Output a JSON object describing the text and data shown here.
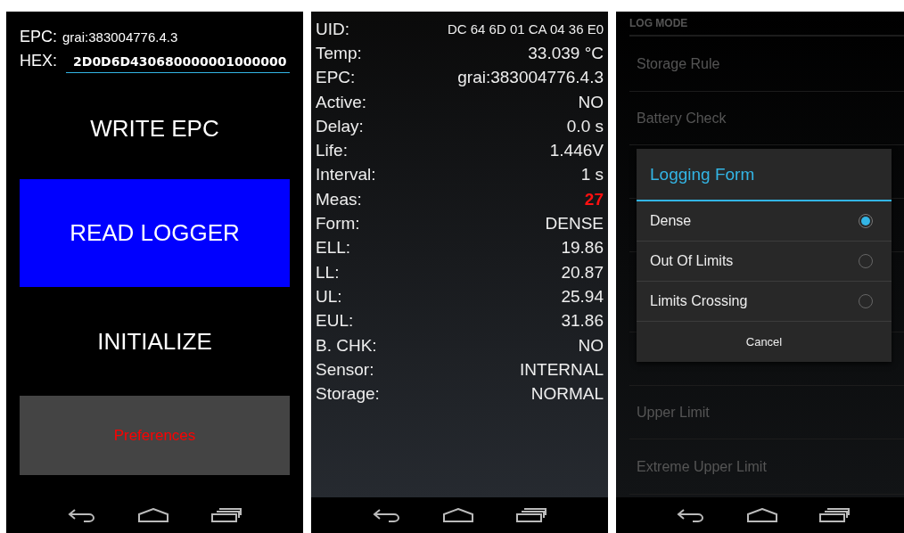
{
  "main_screen": {
    "epc_label": "EPC:",
    "epc_value": "grai:383004776.4.3",
    "hex_label": "HEX:",
    "hex_value": "2D0D6D430680000001000000",
    "buttons": [
      {
        "label": "WRITE EPC",
        "kind": "plain"
      },
      {
        "label": "READ LOGGER",
        "kind": "blue"
      },
      {
        "label": "INITIALIZE",
        "kind": "plain"
      },
      {
        "label": "Preferences",
        "kind": "gray"
      }
    ]
  },
  "logger_screen": {
    "rows": [
      {
        "label": "UID:",
        "value": "DC 64 6D 01 CA 04 36 E0",
        "highlighted": false,
        "small": true
      },
      {
        "label": "Temp:",
        "value": "33.039 °C",
        "highlighted": false,
        "small": false
      },
      {
        "label": "EPC:",
        "value": "grai:383004776.4.3",
        "highlighted": false,
        "small": false
      },
      {
        "label": "Active:",
        "value": "NO",
        "highlighted": false,
        "small": false
      },
      {
        "label": "Delay:",
        "value": "0.0 s",
        "highlighted": false,
        "small": false
      },
      {
        "label": "Life:",
        "value": "1.446V",
        "highlighted": false,
        "small": false
      },
      {
        "label": "Interval:",
        "value": "1 s",
        "highlighted": false,
        "small": false
      },
      {
        "label": "Meas:",
        "value": "27",
        "highlighted": true,
        "small": false
      },
      {
        "label": "Form:",
        "value": "DENSE",
        "highlighted": false,
        "small": false
      },
      {
        "label": "ELL:",
        "value": "19.86",
        "highlighted": false,
        "small": false
      },
      {
        "label": "LL:",
        "value": "20.87",
        "highlighted": false,
        "small": false
      },
      {
        "label": "UL:",
        "value": "25.94",
        "highlighted": false,
        "small": false
      },
      {
        "label": "EUL:",
        "value": "31.86",
        "highlighted": false,
        "small": false
      },
      {
        "label": "B. CHK:",
        "value": "NO",
        "highlighted": false,
        "small": false
      },
      {
        "label": "Sensor:",
        "value": "INTERNAL",
        "highlighted": false,
        "small": false
      },
      {
        "label": "Storage:",
        "value": "NORMAL",
        "highlighted": false,
        "small": false
      }
    ]
  },
  "preferences_screen": {
    "section": "LOG MODE",
    "items": [
      {
        "title": "Storage Rule"
      },
      {
        "title": "Battery Check"
      },
      {
        "title": "Upper Limit"
      },
      {
        "title": "Extreme Upper Limit"
      }
    ],
    "dialog": {
      "title": "Logging Form",
      "options": [
        {
          "label": "Dense",
          "selected": true
        },
        {
          "label": "Out Of Limits",
          "selected": false
        },
        {
          "label": "Limits Crossing",
          "selected": false
        }
      ],
      "cancel": "Cancel"
    }
  }
}
